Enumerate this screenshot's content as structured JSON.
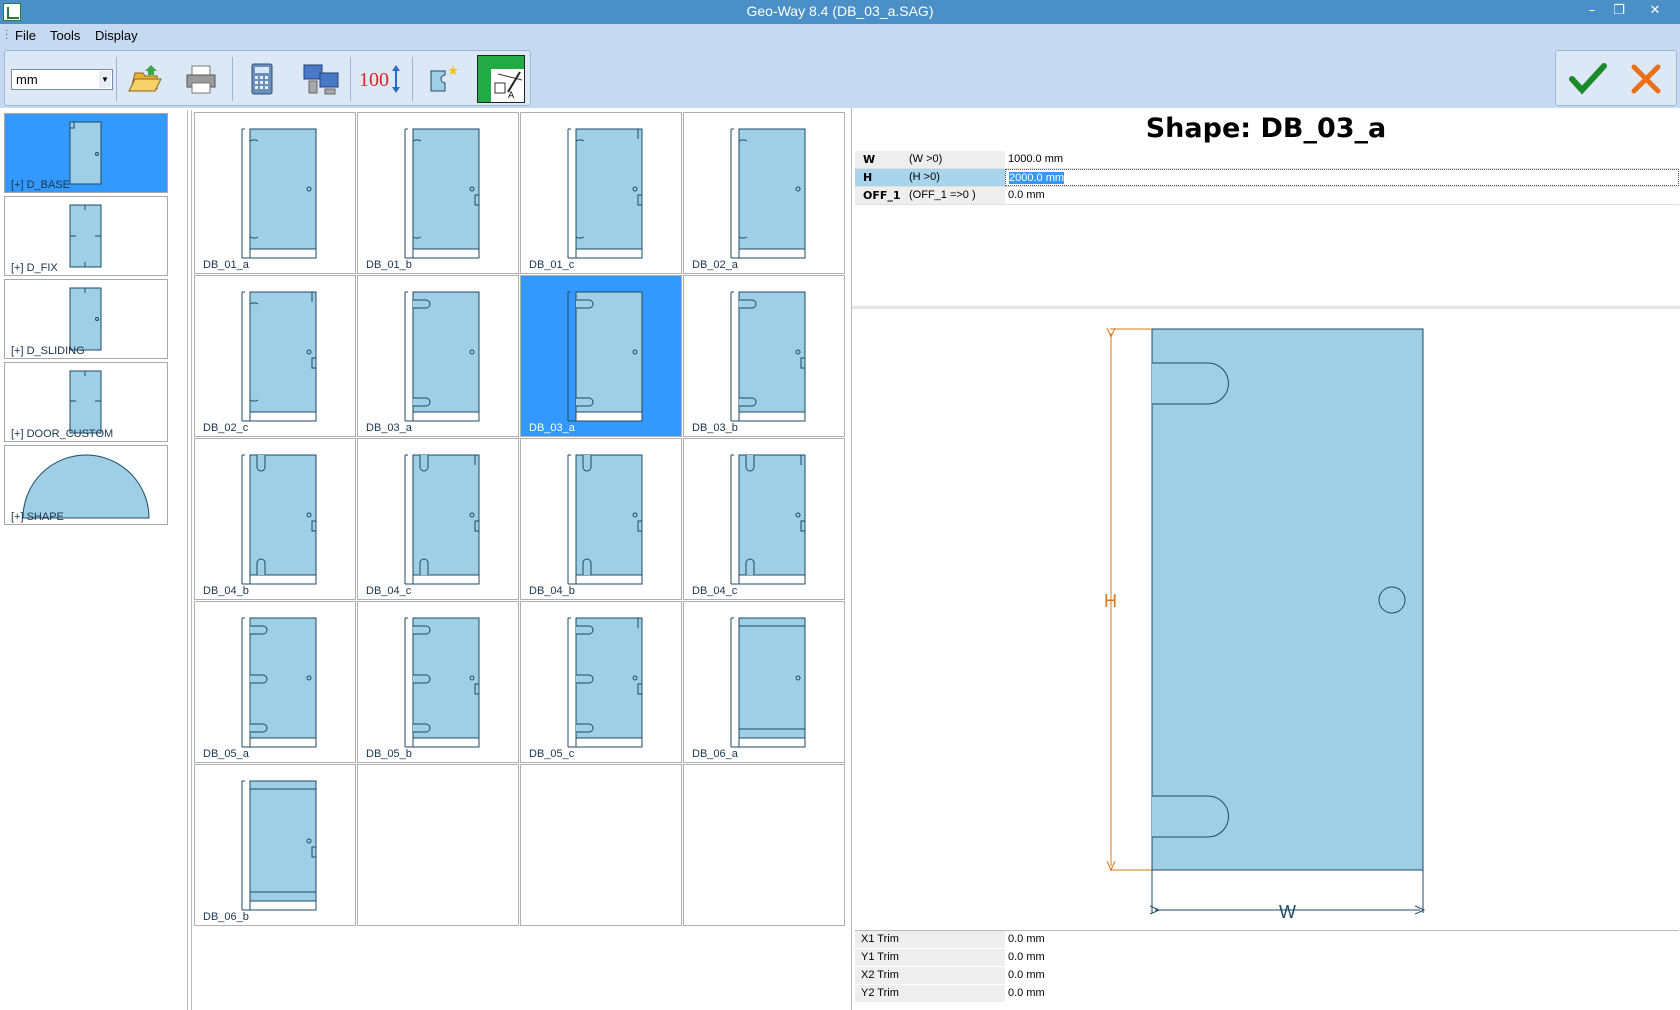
{
  "window": {
    "title": "Geo-Way 8.4 (DB_03_a.SAG)"
  },
  "menu": [
    "File",
    "Tools",
    "Display"
  ],
  "toolbar": {
    "unit": "mm",
    "buttons": [
      "open-folder-icon",
      "print-icon",
      "calculator-icon",
      "network-computers-icon",
      "scale-100-icon",
      "new-shape-icon",
      "edit-drawing-icon"
    ],
    "scale_text": "100"
  },
  "categories": [
    "[+] D_BASE",
    "[+] D_FIX",
    "[+] D_SLIDING",
    "[+] DOOR_CUSTOM",
    "[+] SHAPE"
  ],
  "shapes": [
    {
      "label": "DB_01_a"
    },
    {
      "label": "DB_01_b"
    },
    {
      "label": "DB_01_c"
    },
    {
      "label": "DB_02_a"
    },
    {
      "label": "DB_02_c"
    },
    {
      "label": "DB_03_a"
    },
    {
      "label": "DB_03_a"
    },
    {
      "label": "DB_03_b"
    },
    {
      "label": "DB_04_b"
    },
    {
      "label": "DB_04_c"
    },
    {
      "label": "DB_04_b"
    },
    {
      "label": "DB_04_c"
    },
    {
      "label": "DB_05_a"
    },
    {
      "label": "DB_05_b"
    },
    {
      "label": "DB_05_c"
    },
    {
      "label": "DB_06_a"
    },
    {
      "label": "DB_06_b"
    }
  ],
  "selected_shape_index": 6,
  "shape_title": "Shape: DB_03_a",
  "params": [
    {
      "name": "W",
      "cond": "(W >0)",
      "value": "1000.0 mm"
    },
    {
      "name": "H",
      "cond": "(H >0)",
      "value": "2000.0 mm"
    },
    {
      "name": "OFF_1",
      "cond": "(OFF_1 =>0 )",
      "value": "0.0 mm"
    }
  ],
  "preview": {
    "label_w": "W",
    "label_h": "H"
  },
  "trims": [
    {
      "name": "X1 Trim",
      "value": "0.0 mm"
    },
    {
      "name": "Y1 Trim",
      "value": "0.0 mm"
    },
    {
      "name": "X2 Trim",
      "value": "0.0 mm"
    },
    {
      "name": "Y2 Trim",
      "value": "0.0 mm"
    }
  ],
  "colors": {
    "panel_fill": "#9ecfe4",
    "selection": "#3399ff",
    "dimension": "#d87a1a",
    "outline": "#1e4a66"
  }
}
